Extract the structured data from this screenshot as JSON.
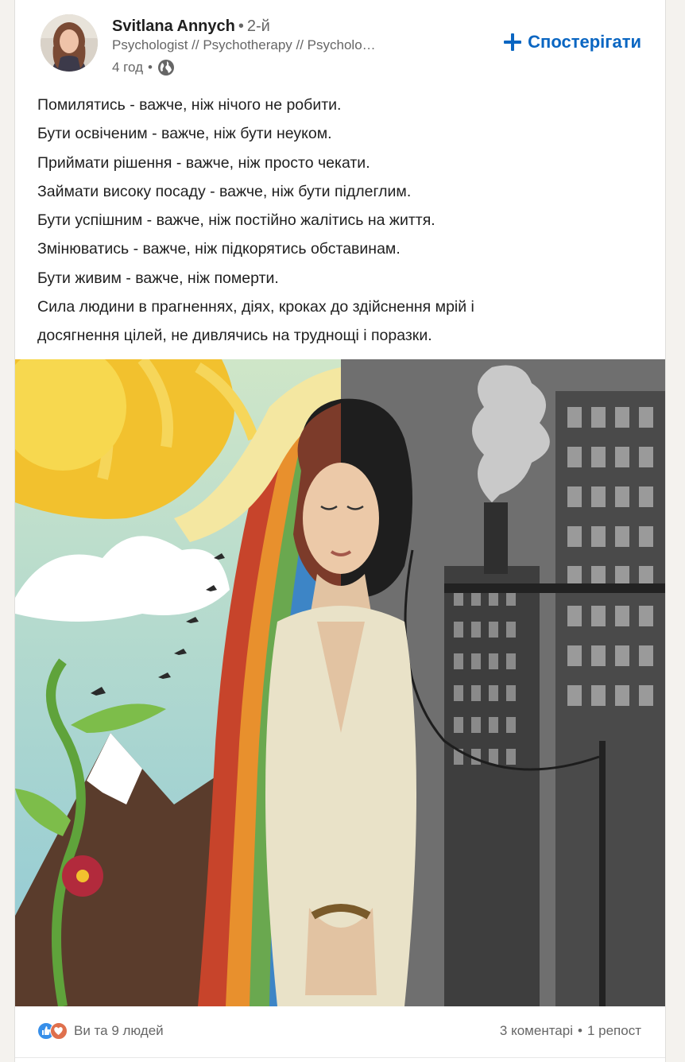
{
  "author": {
    "name": "Svitlana Annych",
    "degree": "2-й",
    "headline": "Psychologist // Psychotherapy // Psychological counseling",
    "time": "4 год",
    "visibility_icon": "globe-icon"
  },
  "follow_button": {
    "label": "Спостерігати",
    "icon": "plus-icon"
  },
  "post": {
    "lines": [
      "Помилятись - важче, ніж нічого не робити.",
      "Бути освіченим - важче, ніж бути неуком.",
      "Приймати рішення - важче, ніж просто чекати.",
      "Займати високу посаду - важче, ніж бути підлеглим.",
      "Бути успішним - важче, ніж постійно жалітись на життя.",
      "Змінюватись - важче, ніж підкорятись обставинам.",
      "Бути живим - важче, ніж померти.",
      "Сила людини в прагненнях, діях, кроках до здійснення мрій і",
      "досягнення цілей, не дивлячись на труднощі і поразки."
    ]
  },
  "social": {
    "reactions_text": "Ви та 9 людей",
    "comments": "3 коментарі",
    "separator": "•",
    "reposts": "1 репост"
  },
  "colors": {
    "accent": "#0a66c2",
    "secondary_text": "#666666"
  }
}
